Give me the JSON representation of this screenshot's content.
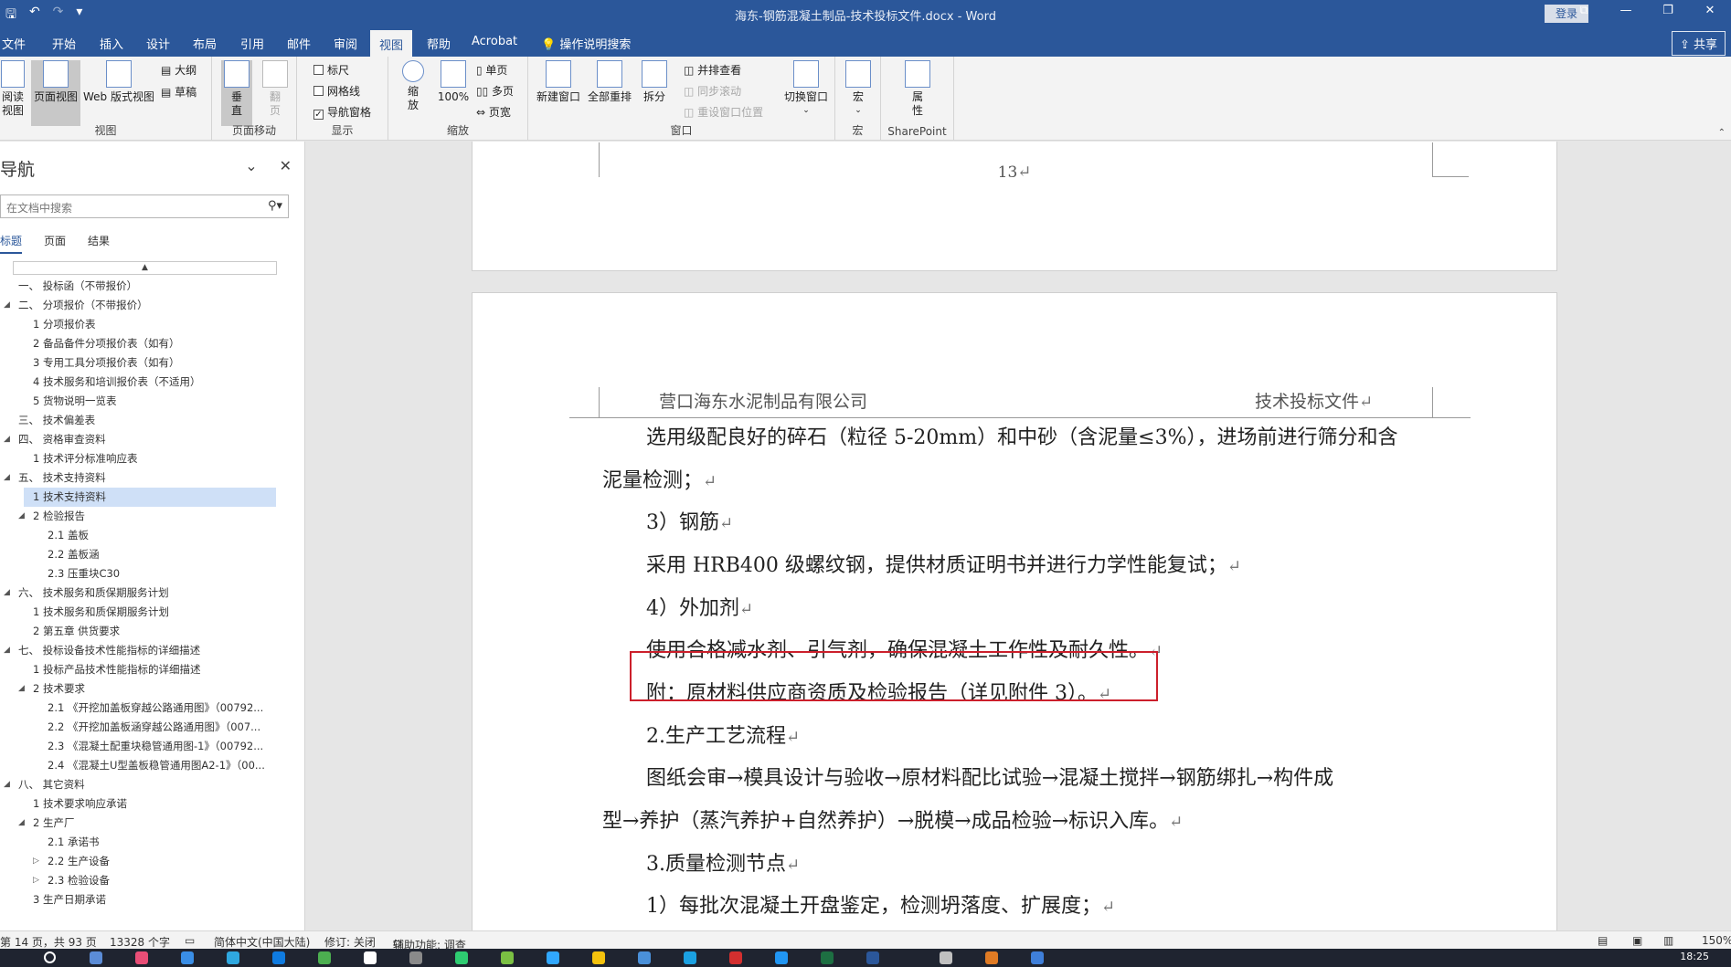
{
  "titlebar": {
    "title": "海东-钢筋混凝土制品-技术投标文件.docx  -  Word",
    "login": "登录",
    "save_glyph": "🖫",
    "undo_glyph": "↶",
    "redo_glyph": "↷",
    "qat_glyph": "▾",
    "ribbon_opts_glyph": "⧉",
    "minimize_glyph": "—",
    "restore_glyph": "❐",
    "close_glyph": "✕"
  },
  "tabs": {
    "file": "文件",
    "home": "开始",
    "insert": "插入",
    "design": "设计",
    "layout": "布局",
    "references": "引用",
    "mailings": "邮件",
    "review": "审阅",
    "view": "视图",
    "help": "帮助",
    "acrobat": "Acrobat",
    "tellme": "操作说明搜索",
    "share": "共享"
  },
  "ribbon": {
    "views": {
      "read": "阅读\n视图",
      "print": "页面视图",
      "web": "Web 版式视图",
      "outline": "大纲",
      "draft": "草稿",
      "label": "视图"
    },
    "movement": {
      "vertical": "垂\n直",
      "side": "翻\n页",
      "label": "页面移动"
    },
    "show": {
      "ruler": "标尺",
      "grid": "网格线",
      "navpane": "导航窗格",
      "label": "显示"
    },
    "zoom": {
      "zoom": "缩\n放",
      "zoom100": "100%",
      "onepage": "单页",
      "multipage": "多页",
      "pagewidth": "页宽",
      "label": "缩放"
    },
    "window": {
      "newwin": "新建窗口",
      "arrange": "全部重排",
      "split": "拆分",
      "sidebyside": "并排查看",
      "syncscroll": "同步滚动",
      "resetpos": "重设窗口位置",
      "switch": "切换窗口",
      "label": "窗口"
    },
    "macros": {
      "macros": "宏",
      "label": "宏"
    },
    "sharepoint": {
      "props": "属\n性",
      "label": "SharePoint"
    }
  },
  "nav": {
    "title": "导航",
    "search_placeholder": "在文档中搜索",
    "tabs": {
      "headings": "标题",
      "pages": "页面",
      "results": "结果"
    },
    "items": [
      {
        "level": 1,
        "label": "一、 投标函（不带报价）",
        "twisty": ""
      },
      {
        "level": 1,
        "label": "二、 分项报价（不带报价）",
        "twisty": "◢"
      },
      {
        "level": 2,
        "label": "1 分项报价表",
        "twisty": ""
      },
      {
        "level": 2,
        "label": "2 备品备件分项报价表（如有）",
        "twisty": ""
      },
      {
        "level": 2,
        "label": "3 专用工具分项报价表（如有）",
        "twisty": ""
      },
      {
        "level": 2,
        "label": "4 技术服务和培训报价表（不适用）",
        "twisty": ""
      },
      {
        "level": 2,
        "label": "5 货物说明一览表",
        "twisty": ""
      },
      {
        "level": 1,
        "label": "三、 技术偏差表",
        "twisty": ""
      },
      {
        "level": 1,
        "label": "四、 资格审查资料",
        "twisty": "◢"
      },
      {
        "level": 2,
        "label": "1 技术评分标准响应表",
        "twisty": ""
      },
      {
        "level": 1,
        "label": "五、 技术支持资料",
        "twisty": "◢"
      },
      {
        "level": 2,
        "label": "1 技术支持资料",
        "twisty": "",
        "selected": true
      },
      {
        "level": 2,
        "label": "2 检验报告",
        "twisty": "◢"
      },
      {
        "level": 3,
        "label": "2.1 盖板",
        "twisty": ""
      },
      {
        "level": 3,
        "label": "2.2 盖板涵",
        "twisty": ""
      },
      {
        "level": 3,
        "label": "2.3 压重块C30",
        "twisty": ""
      },
      {
        "level": 1,
        "label": "六、 技术服务和质保期服务计划",
        "twisty": "◢"
      },
      {
        "level": 2,
        "label": "1 技术服务和质保期服务计划",
        "twisty": ""
      },
      {
        "level": 2,
        "label": "2 第五章  供货要求",
        "twisty": ""
      },
      {
        "level": 1,
        "label": "七、 投标设备技术性能指标的详细描述",
        "twisty": "◢"
      },
      {
        "level": 2,
        "label": "1 投标产品技术性能指标的详细描述",
        "twisty": ""
      },
      {
        "level": 2,
        "label": "2 技术要求",
        "twisty": "◢"
      },
      {
        "level": 3,
        "label": "2.1 《开挖加盖板穿越公路通用图》（00792...",
        "twisty": ""
      },
      {
        "level": 3,
        "label": "2.2 《开挖加盖板涵穿越公路通用图》（007...",
        "twisty": ""
      },
      {
        "level": 3,
        "label": "2.3 《混凝土配重块稳管通用图-1》（00792...",
        "twisty": ""
      },
      {
        "level": 3,
        "label": "2.4 《混凝土U型盖板稳管通用图A2-1》（00...",
        "twisty": ""
      },
      {
        "level": 1,
        "label": "八、 其它资料",
        "twisty": "◢"
      },
      {
        "level": 2,
        "label": "1 技术要求响应承诺",
        "twisty": ""
      },
      {
        "level": 2,
        "label": "2 生产厂",
        "twisty": "◢"
      },
      {
        "level": 3,
        "label": "2.1 承诺书",
        "twisty": ""
      },
      {
        "level": 3,
        "label": "2.2 生产设备",
        "twisty": "▷"
      },
      {
        "level": 3,
        "label": "2.3 检验设备",
        "twisty": "▷"
      },
      {
        "level": 2,
        "label": "3 生产日期承诺",
        "twisty": ""
      }
    ]
  },
  "document": {
    "prev_page_number": "13",
    "header_left": "营口海东水泥制品有限公司",
    "header_right": "技术投标文件",
    "para_mark": "↵",
    "lines": [
      "选用级配良好的碎石（粒径 5-20mm）和中砂（含泥量≤3%），进场前进行筛分和含",
      "泥量检测；",
      "3）钢筋",
      "采用 HRB400 级螺纹钢，提供材质证明书并进行力学性能复试；",
      "4）外加剂",
      "使用合格减水剂、引气剂，确保混凝土工作性及耐久性。",
      "附：原材料供应商资质及检验报告（详见附件 3）。",
      "2.生产工艺流程",
      "图纸会审→模具设计与验收→原材料配比试验→混凝土搅拌→钢筋绑扎→构件成",
      "型→养护（蒸汽养护+自然养护）→脱模→成品检验→标识入库。",
      "3.质量检测节点",
      "1）每批次混凝土开盘鉴定，检测坍落度、扩展度；"
    ]
  },
  "statusbar": {
    "page": "第 14 页，共 93 页",
    "words": "13328 个字",
    "language": "简体中文(中国大陆)",
    "track": "修订: 关闭",
    "accessibility": "辅助功能: 调查",
    "zoom": "150%"
  },
  "taskbar": {
    "clock": "18:25"
  },
  "colors": {
    "accent": "#2b579a",
    "highlight_box": "#cc1f2b",
    "nav_selected": "#cfe0f7"
  }
}
